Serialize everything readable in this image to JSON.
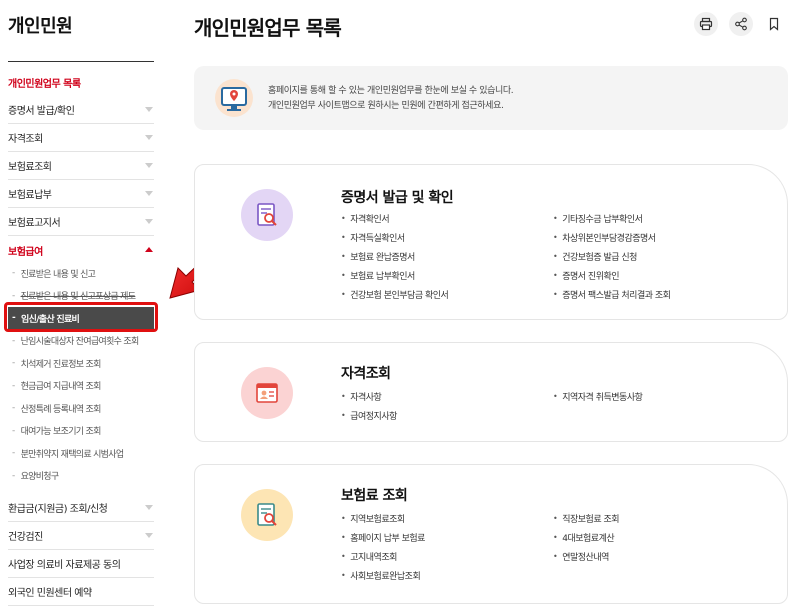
{
  "sidebar": {
    "title": "개인민원",
    "active_top": "개인민원업무 목록",
    "items": [
      {
        "label": "증명서 발급/확인"
      },
      {
        "label": "자격조회"
      },
      {
        "label": "보험료조회"
      },
      {
        "label": "보험료납부"
      },
      {
        "label": "보험료고지서"
      },
      {
        "label": "보험급여"
      }
    ],
    "sub_items": [
      {
        "label": "진료받은 내용 및 신고"
      },
      {
        "label": "진료받은 내용 및 신고포상금 제도"
      },
      {
        "label": "임신/출산 진료비"
      },
      {
        "label": "난임시술대상자 잔여급여횟수 조회"
      },
      {
        "label": "치석제거 진료정보 조회"
      },
      {
        "label": "현금급여 지급내역 조회"
      },
      {
        "label": "산정특례 등록내역 조회"
      },
      {
        "label": "대여가능 보조기기 조회"
      },
      {
        "label": "분만취약지 재택의료 시범사업"
      },
      {
        "label": "요양비청구"
      }
    ],
    "items_after": [
      {
        "label": "환급금(지원금) 조회/신청"
      },
      {
        "label": "건강검진"
      },
      {
        "label": "사업장 의료비 자료제공 동의"
      },
      {
        "label": "외국인 민원센터 예약"
      }
    ]
  },
  "main": {
    "title": "개인민원업무 목록",
    "tools": [
      {
        "icon": "print-icon"
      },
      {
        "icon": "share-icon"
      },
      {
        "icon": "bookmark-icon"
      }
    ],
    "notice": {
      "line1": "홈페이지를 통해 할 수 있는 개인민원업무를 한눈에 보실 수 있습니다.",
      "line2": "개인민원업무 사이트맵으로 원하시는 민원에 간편하게 접근하세요."
    },
    "cards": [
      {
        "title": "증명서 발급 및 확인",
        "icon": "certificate-search-icon",
        "icon_bg": "#e3d6f5",
        "left": [
          "자격확인서",
          "자격득실확인서",
          "보험료 완납증명서",
          "보험료 납부확인서",
          "건강보험 본인부담금 확인서"
        ],
        "right": [
          "기타징수금 납부확인서",
          "차상위본인부담경감증명서",
          "건강보험증 발급 신청",
          "증명서 진위확인",
          "증명서 팩스발급 처리결과 조회"
        ]
      },
      {
        "title": "자격조회",
        "icon": "id-card-icon",
        "icon_bg": "#fbd3d3",
        "left": [
          "자격사항",
          "급여정지사항"
        ],
        "right": [
          "지역자격 취득변동사항"
        ]
      },
      {
        "title": "보험료 조회",
        "icon": "document-search-icon",
        "icon_bg": "#fde5b4",
        "left": [
          "지역보험료조회",
          "홈페이지 납부 보험료",
          "고지내역조회",
          "사회보험료완납조회"
        ],
        "right": [
          "직장보험료 조회",
          "4대보험료계산",
          "연말정산내역"
        ]
      }
    ]
  },
  "colors": {
    "accent": "#d0021b",
    "selected_bg": "#4a4a4a"
  }
}
